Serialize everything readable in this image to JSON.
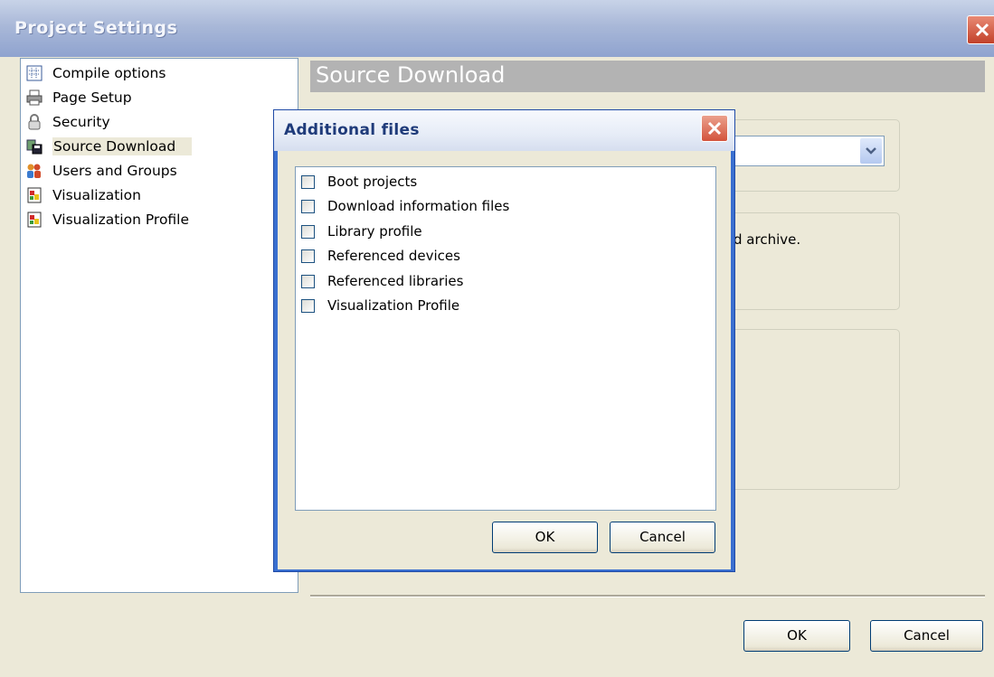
{
  "window": {
    "title": "Project Settings",
    "close_icon": "close-icon"
  },
  "nav": {
    "items": [
      {
        "label": "Compile options",
        "icon": "compile-icon"
      },
      {
        "label": "Page Setup",
        "icon": "printer-icon"
      },
      {
        "label": "Security",
        "icon": "lock-icon"
      },
      {
        "label": "Source Download",
        "icon": "source-download-icon",
        "selected": true
      },
      {
        "label": "Users and Groups",
        "icon": "users-icon"
      },
      {
        "label": "Visualization",
        "icon": "visualization-icon"
      },
      {
        "label": "Visualization Profile",
        "icon": "visualization-profile-icon"
      }
    ]
  },
  "section": {
    "title": "Source Download",
    "partial_text": "d archive."
  },
  "buttons": {
    "ok": "OK",
    "cancel": "Cancel"
  },
  "dialog": {
    "title": "Additional files",
    "items": [
      {
        "label": "Boot projects",
        "checked": false
      },
      {
        "label": "Download information files",
        "checked": false
      },
      {
        "label": "Library profile",
        "checked": false
      },
      {
        "label": "Referenced devices",
        "checked": false
      },
      {
        "label": "Referenced libraries",
        "checked": false
      },
      {
        "label": "Visualization Profile",
        "checked": false
      }
    ],
    "ok": "OK",
    "cancel": "Cancel"
  },
  "colors": {
    "dialog_frame": "#3a6fd0",
    "window_bg": "#ece9d8",
    "header_gray": "#b3b3b3"
  }
}
